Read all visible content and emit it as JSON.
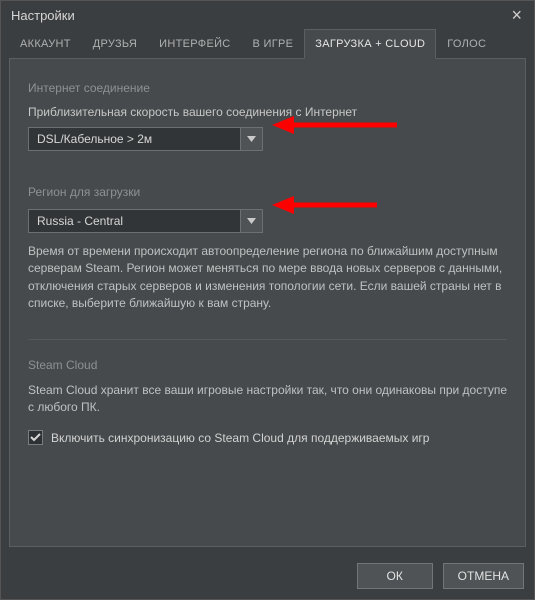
{
  "window": {
    "title": "Настройки"
  },
  "tabs": [
    {
      "label": "АККАУНТ"
    },
    {
      "label": "ДРУЗЬЯ"
    },
    {
      "label": "ИНТЕРФЕЙС"
    },
    {
      "label": "В ИГРЕ"
    },
    {
      "label": "ЗАГРУЗКА + CLOUD"
    },
    {
      "label": "ГОЛОС"
    }
  ],
  "internet": {
    "heading": "Интернет соединение",
    "speed_label": "Приблизительная скорость вашего соединения с Интернет",
    "speed_value": "DSL/Кабельное > 2м"
  },
  "region": {
    "heading": "Регион для загрузки",
    "value": "Russia - Central",
    "help": "Время от времени происходит автоопределение региона по ближайшим доступным серверам Steam. Регион может меняться по мере ввода новых серверов с данными, отключения старых серверов и изменения топологии сети. Если вашей страны нет в списке, выберите ближайшую к вам страну."
  },
  "cloud": {
    "heading": "Steam Cloud",
    "desc": "Steam Cloud хранит все ваши игровые настройки так, что они одинаковы при доступе с любого ПК.",
    "checkbox_label": "Включить синхронизацию со Steam Cloud для поддерживаемых игр"
  },
  "footer": {
    "ok": "ОК",
    "cancel": "ОТМЕНА"
  }
}
